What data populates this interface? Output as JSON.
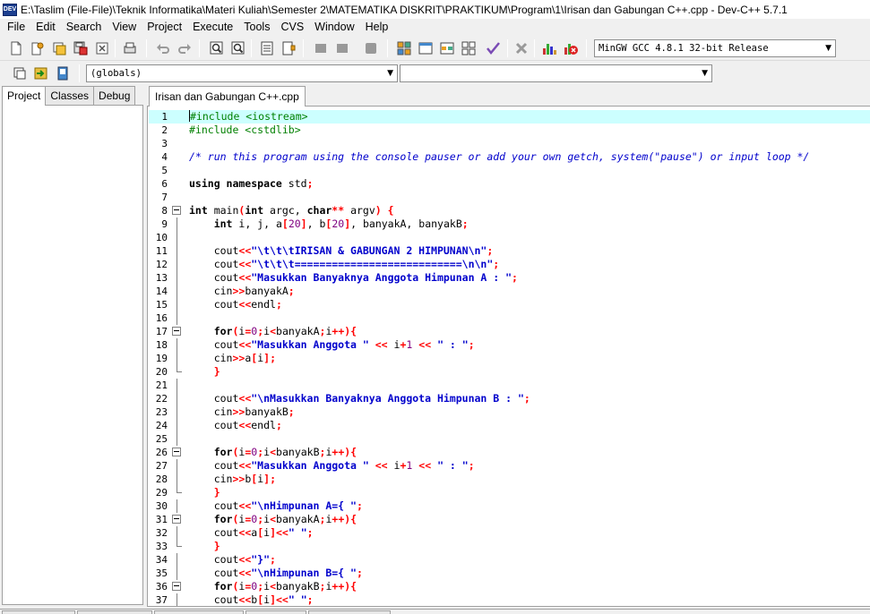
{
  "window": {
    "title": "E:\\Taslim (File-File)\\Teknik Informatika\\Materi Kuliah\\Semester 2\\MATEMATIKA DISKRIT\\PRAKTIKUM\\Program\\1\\Irisan dan Gabungan C++.cpp - Dev-C++ 5.7.1",
    "app_icon_text": "DEV"
  },
  "menu": [
    "File",
    "Edit",
    "Search",
    "View",
    "Project",
    "Execute",
    "Tools",
    "CVS",
    "Window",
    "Help"
  ],
  "toolbar": {
    "compiler_select": "MinGW GCC 4.8.1 32-bit Release",
    "globals_select": "(globals)",
    "members_select": ""
  },
  "left_panel": {
    "tabs": [
      "Project",
      "Classes",
      "Debug"
    ],
    "active_tab": "Project"
  },
  "editor": {
    "file_tab": "Irisan dan Gabungan C++.cpp",
    "colors": {
      "keyword": "#000000",
      "string": "#0000cc",
      "comment": "#0000cc",
      "preprocessor": "#008000",
      "number": "#800080",
      "symbol": "#ff0000",
      "current_line": "#ccffff"
    },
    "lines": [
      {
        "n": "1",
        "fold": "",
        "tokens": [
          [
            "p",
            "#include <iostream>"
          ]
        ]
      },
      {
        "n": "2",
        "fold": "",
        "tokens": [
          [
            "p",
            "#include <cstdlib>"
          ]
        ]
      },
      {
        "n": "3",
        "fold": "",
        "tokens": []
      },
      {
        "n": "4",
        "fold": "",
        "tokens": [
          [
            "c",
            "/* run this program using the console pauser or add your own getch, system(\"pause\") or input loop */"
          ]
        ]
      },
      {
        "n": "5",
        "fold": "",
        "tokens": []
      },
      {
        "n": "6",
        "fold": "",
        "tokens": [
          [
            "k",
            "using namespace"
          ],
          [
            "t",
            " std"
          ],
          [
            "s",
            ";"
          ]
        ]
      },
      {
        "n": "7",
        "fold": "",
        "tokens": []
      },
      {
        "n": "8",
        "fold": "open",
        "tokens": [
          [
            "k",
            "int"
          ],
          [
            "t",
            " main"
          ],
          [
            "s",
            "("
          ],
          [
            "k",
            "int"
          ],
          [
            "t",
            " argc, "
          ],
          [
            "k",
            "char"
          ],
          [
            "s",
            "**"
          ],
          [
            "t",
            " argv"
          ],
          [
            "s",
            ") {"
          ]
        ]
      },
      {
        "n": "9",
        "fold": "line",
        "tokens": [
          [
            "t",
            "    "
          ],
          [
            "k",
            "int"
          ],
          [
            "t",
            " i, j, a"
          ],
          [
            "s",
            "["
          ],
          [
            "n",
            "20"
          ],
          [
            "s",
            "]"
          ],
          [
            "t",
            ", b"
          ],
          [
            "s",
            "["
          ],
          [
            "n",
            "20"
          ],
          [
            "s",
            "]"
          ],
          [
            "t",
            ", banyakA, banyakB"
          ],
          [
            "s",
            ";"
          ]
        ]
      },
      {
        "n": "10",
        "fold": "line",
        "tokens": []
      },
      {
        "n": "11",
        "fold": "line",
        "tokens": [
          [
            "t",
            "    cout"
          ],
          [
            "s",
            "<<"
          ],
          [
            "q",
            "\"\\t\\t\\tIRISAN & GABUNGAN 2 HIMPUNAN\\n\""
          ],
          [
            "s",
            ";"
          ]
        ]
      },
      {
        "n": "12",
        "fold": "line",
        "tokens": [
          [
            "t",
            "    cout"
          ],
          [
            "s",
            "<<"
          ],
          [
            "q",
            "\"\\t\\t\\t===========================\\n\\n\""
          ],
          [
            "s",
            ";"
          ]
        ]
      },
      {
        "n": "13",
        "fold": "line",
        "tokens": [
          [
            "t",
            "    cout"
          ],
          [
            "s",
            "<<"
          ],
          [
            "q",
            "\"Masukkan Banyaknya Anggota Himpunan A : \""
          ],
          [
            "s",
            ";"
          ]
        ]
      },
      {
        "n": "14",
        "fold": "line",
        "tokens": [
          [
            "t",
            "    cin"
          ],
          [
            "s",
            ">>"
          ],
          [
            "t",
            "banyakA"
          ],
          [
            "s",
            ";"
          ]
        ]
      },
      {
        "n": "15",
        "fold": "line",
        "tokens": [
          [
            "t",
            "    cout"
          ],
          [
            "s",
            "<<"
          ],
          [
            "t",
            "endl"
          ],
          [
            "s",
            ";"
          ]
        ]
      },
      {
        "n": "16",
        "fold": "line",
        "tokens": []
      },
      {
        "n": "17",
        "fold": "open",
        "tokens": [
          [
            "t",
            "    "
          ],
          [
            "k",
            "for"
          ],
          [
            "s",
            "("
          ],
          [
            "t",
            "i"
          ],
          [
            "s",
            "="
          ],
          [
            "n",
            "0"
          ],
          [
            "s",
            ";"
          ],
          [
            "t",
            "i"
          ],
          [
            "s",
            "<"
          ],
          [
            "t",
            "banyakA"
          ],
          [
            "s",
            ";"
          ],
          [
            "t",
            "i"
          ],
          [
            "s",
            "++){"
          ]
        ]
      },
      {
        "n": "18",
        "fold": "line",
        "tokens": [
          [
            "t",
            "    cout"
          ],
          [
            "s",
            "<<"
          ],
          [
            "q",
            "\"Masukkan Anggota \""
          ],
          [
            "t",
            " "
          ],
          [
            "s",
            "<<"
          ],
          [
            "t",
            " i"
          ],
          [
            "s",
            "+"
          ],
          [
            "n",
            "1"
          ],
          [
            "t",
            " "
          ],
          [
            "s",
            "<<"
          ],
          [
            "t",
            " "
          ],
          [
            "q",
            "\" : \""
          ],
          [
            "s",
            ";"
          ]
        ]
      },
      {
        "n": "19",
        "fold": "line",
        "tokens": [
          [
            "t",
            "    cin"
          ],
          [
            "s",
            ">>"
          ],
          [
            "t",
            "a"
          ],
          [
            "s",
            "["
          ],
          [
            "t",
            "i"
          ],
          [
            "s",
            "];"
          ]
        ]
      },
      {
        "n": "20",
        "fold": "end",
        "tokens": [
          [
            "t",
            "    "
          ],
          [
            "s",
            "}"
          ]
        ]
      },
      {
        "n": "21",
        "fold": "line",
        "tokens": []
      },
      {
        "n": "22",
        "fold": "line",
        "tokens": [
          [
            "t",
            "    cout"
          ],
          [
            "s",
            "<<"
          ],
          [
            "q",
            "\"\\nMasukkan Banyaknya Anggota Himpunan B : \""
          ],
          [
            "s",
            ";"
          ]
        ]
      },
      {
        "n": "23",
        "fold": "line",
        "tokens": [
          [
            "t",
            "    cin"
          ],
          [
            "s",
            ">>"
          ],
          [
            "t",
            "banyakB"
          ],
          [
            "s",
            ";"
          ]
        ]
      },
      {
        "n": "24",
        "fold": "line",
        "tokens": [
          [
            "t",
            "    cout"
          ],
          [
            "s",
            "<<"
          ],
          [
            "t",
            "endl"
          ],
          [
            "s",
            ";"
          ]
        ]
      },
      {
        "n": "25",
        "fold": "line",
        "tokens": []
      },
      {
        "n": "26",
        "fold": "open",
        "tokens": [
          [
            "t",
            "    "
          ],
          [
            "k",
            "for"
          ],
          [
            "s",
            "("
          ],
          [
            "t",
            "i"
          ],
          [
            "s",
            "="
          ],
          [
            "n",
            "0"
          ],
          [
            "s",
            ";"
          ],
          [
            "t",
            "i"
          ],
          [
            "s",
            "<"
          ],
          [
            "t",
            "banyakB"
          ],
          [
            "s",
            ";"
          ],
          [
            "t",
            "i"
          ],
          [
            "s",
            "++){"
          ]
        ]
      },
      {
        "n": "27",
        "fold": "line",
        "tokens": [
          [
            "t",
            "    cout"
          ],
          [
            "s",
            "<<"
          ],
          [
            "q",
            "\"Masukkan Anggota \""
          ],
          [
            "t",
            " "
          ],
          [
            "s",
            "<<"
          ],
          [
            "t",
            " i"
          ],
          [
            "s",
            "+"
          ],
          [
            "n",
            "1"
          ],
          [
            "t",
            " "
          ],
          [
            "s",
            "<<"
          ],
          [
            "t",
            " "
          ],
          [
            "q",
            "\" : \""
          ],
          [
            "s",
            ";"
          ]
        ]
      },
      {
        "n": "28",
        "fold": "line",
        "tokens": [
          [
            "t",
            "    cin"
          ],
          [
            "s",
            ">>"
          ],
          [
            "t",
            "b"
          ],
          [
            "s",
            "["
          ],
          [
            "t",
            "i"
          ],
          [
            "s",
            "];"
          ]
        ]
      },
      {
        "n": "29",
        "fold": "end",
        "tokens": [
          [
            "t",
            "    "
          ],
          [
            "s",
            "}"
          ]
        ]
      },
      {
        "n": "30",
        "fold": "line",
        "tokens": [
          [
            "t",
            "    cout"
          ],
          [
            "s",
            "<<"
          ],
          [
            "q",
            "\"\\nHimpunan A={ \""
          ],
          [
            "s",
            ";"
          ]
        ]
      },
      {
        "n": "31",
        "fold": "open",
        "tokens": [
          [
            "t",
            "    "
          ],
          [
            "k",
            "for"
          ],
          [
            "s",
            "("
          ],
          [
            "t",
            "i"
          ],
          [
            "s",
            "="
          ],
          [
            "n",
            "0"
          ],
          [
            "s",
            ";"
          ],
          [
            "t",
            "i"
          ],
          [
            "s",
            "<"
          ],
          [
            "t",
            "banyakA"
          ],
          [
            "s",
            ";"
          ],
          [
            "t",
            "i"
          ],
          [
            "s",
            "++){"
          ]
        ]
      },
      {
        "n": "32",
        "fold": "line",
        "tokens": [
          [
            "t",
            "    cout"
          ],
          [
            "s",
            "<<"
          ],
          [
            "t",
            "a"
          ],
          [
            "s",
            "["
          ],
          [
            "t",
            "i"
          ],
          [
            "s",
            "]<<"
          ],
          [
            "q",
            "\" \""
          ],
          [
            "s",
            ";"
          ]
        ]
      },
      {
        "n": "33",
        "fold": "end",
        "tokens": [
          [
            "t",
            "    "
          ],
          [
            "s",
            "}"
          ]
        ]
      },
      {
        "n": "34",
        "fold": "line",
        "tokens": [
          [
            "t",
            "    cout"
          ],
          [
            "s",
            "<<"
          ],
          [
            "q",
            "\"}\""
          ],
          [
            "s",
            ";"
          ]
        ]
      },
      {
        "n": "35",
        "fold": "line",
        "tokens": [
          [
            "t",
            "    cout"
          ],
          [
            "s",
            "<<"
          ],
          [
            "q",
            "\"\\nHimpunan B={ \""
          ],
          [
            "s",
            ";"
          ]
        ]
      },
      {
        "n": "36",
        "fold": "open",
        "tokens": [
          [
            "t",
            "    "
          ],
          [
            "k",
            "for"
          ],
          [
            "s",
            "("
          ],
          [
            "t",
            "i"
          ],
          [
            "s",
            "="
          ],
          [
            "n",
            "0"
          ],
          [
            "s",
            ";"
          ],
          [
            "t",
            "i"
          ],
          [
            "s",
            "<"
          ],
          [
            "t",
            "banyakB"
          ],
          [
            "s",
            ";"
          ],
          [
            "t",
            "i"
          ],
          [
            "s",
            "++){"
          ]
        ]
      },
      {
        "n": "37",
        "fold": "line",
        "tokens": [
          [
            "t",
            "    cout"
          ],
          [
            "s",
            "<<"
          ],
          [
            "t",
            "b"
          ],
          [
            "s",
            "["
          ],
          [
            "t",
            "i"
          ],
          [
            "s",
            "]<<"
          ],
          [
            "q",
            "\" \""
          ],
          [
            "s",
            ";"
          ]
        ]
      }
    ]
  }
}
